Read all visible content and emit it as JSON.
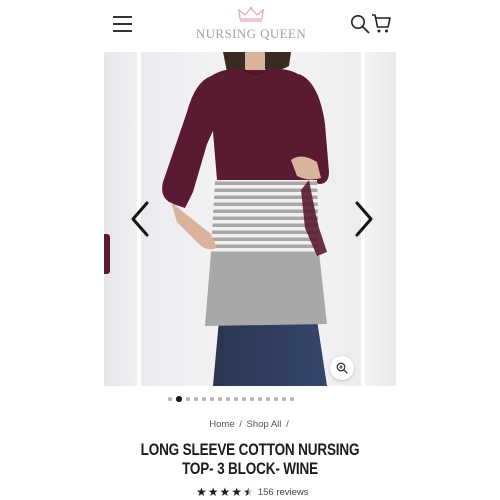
{
  "header": {
    "logo_text": "NURSING QUEEN",
    "menu_icon": "hamburger-menu-icon",
    "search_icon": "search-icon",
    "cart_icon": "shopping-cart-icon",
    "logo_color": "#a3a3a3",
    "crown_color": "#e4a6c0"
  },
  "carousel": {
    "current_index": 2,
    "total_slides": 16,
    "prev_icon": "chevron-left-icon",
    "next_icon": "chevron-right-icon",
    "zoom_icon": "zoom-icon",
    "product_colors": {
      "top_block": "#5a1a32",
      "middle_stripes": [
        "#f3f1ef",
        "#a9a7a6"
      ],
      "bottom_block": "#a8a8a8",
      "jeans": "#2d3a55"
    }
  },
  "breadcrumb": {
    "home": "Home",
    "separator": "/",
    "category": "Shop All",
    "trailing": "/"
  },
  "product": {
    "title": "LONG SLEEVE COTTON NURSING TOP- 3 BLOCK- WINE",
    "rating": 4.5,
    "rating_max": 5,
    "review_count": "156 reviews"
  }
}
